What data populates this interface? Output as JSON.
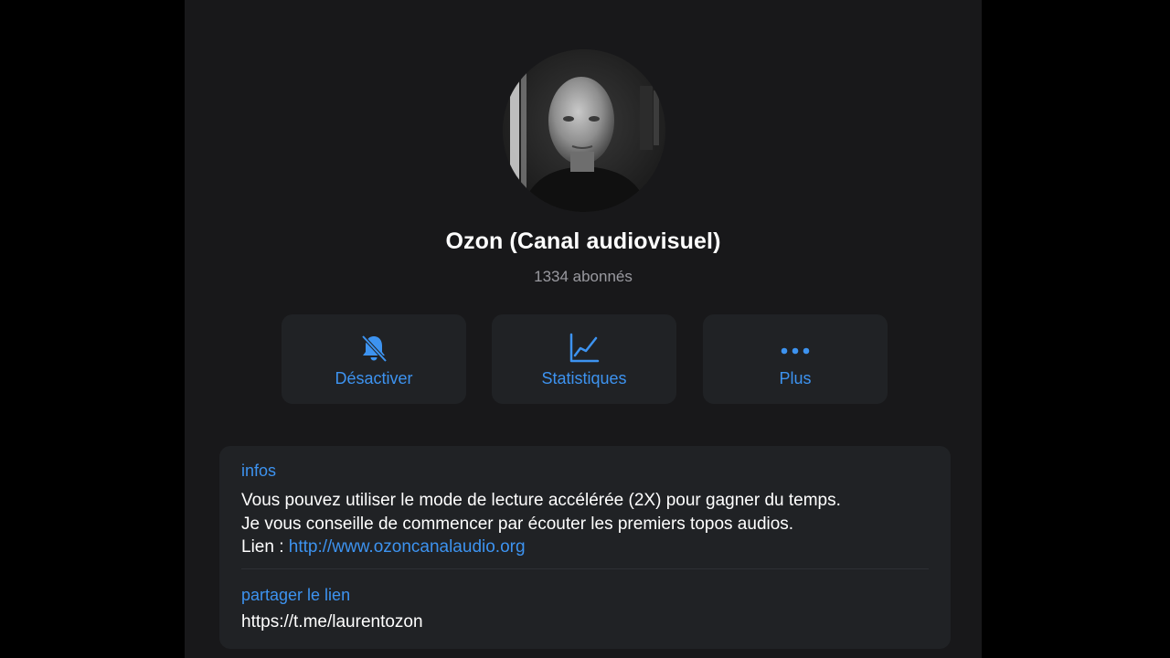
{
  "profile": {
    "name": "Ozon (Canal audiovisuel)",
    "subscribers": "1334 abonnés"
  },
  "actions": [
    {
      "label": "Désactiver",
      "icon": "bell-slash-icon"
    },
    {
      "label": "Statistiques",
      "icon": "stats-chart-icon"
    },
    {
      "label": "Plus",
      "icon": "more-dots-icon"
    }
  ],
  "info": {
    "label": "infos",
    "line1": "Vous pouvez utiliser le mode de lecture accélérée (2X) pour gagner du temps.",
    "line2": "Je vous conseille de commencer par écouter les premiers topos audios.",
    "link_prefix": "Lien : ",
    "link_url": "http://www.ozoncanalaudio.org"
  },
  "share": {
    "label": "partager le lien",
    "url": "https://t.me/laurentozon"
  },
  "colors": {
    "background": "#000000",
    "panel": "#18181a",
    "card": "#202225",
    "accent": "#3d93f0",
    "secondary_text": "#9a9aa0"
  }
}
